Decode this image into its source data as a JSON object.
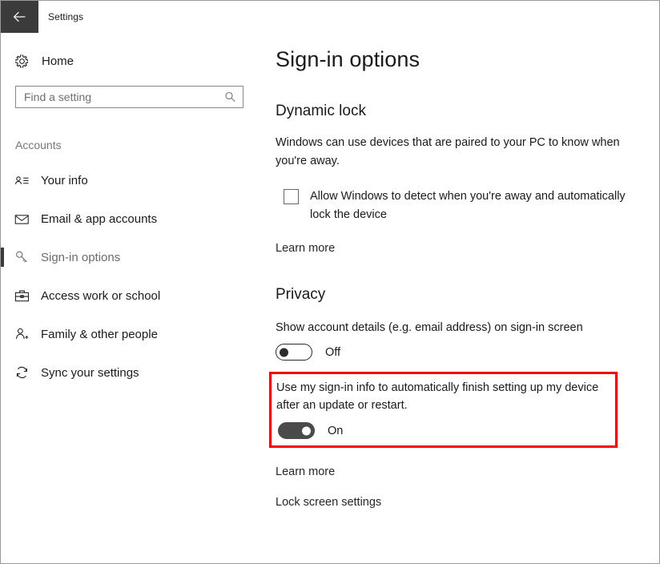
{
  "window": {
    "titlebar": {
      "back_icon": "back-arrow-icon",
      "title": "Settings"
    }
  },
  "sidebar": {
    "home": {
      "icon": "gear-icon",
      "label": "Home"
    },
    "search": {
      "placeholder": "Find a setting",
      "value": "",
      "icon": "search-icon"
    },
    "group_title": "Accounts",
    "items": [
      {
        "icon": "contact-card-icon",
        "label": "Your info",
        "selected": false
      },
      {
        "icon": "envelope-icon",
        "label": "Email & app accounts",
        "selected": false
      },
      {
        "icon": "key-icon",
        "label": "Sign-in options",
        "selected": true
      },
      {
        "icon": "briefcase-icon",
        "label": "Access work or school",
        "selected": false
      },
      {
        "icon": "person-add-icon",
        "label": "Family & other people",
        "selected": false
      },
      {
        "icon": "sync-icon",
        "label": "Sync your settings",
        "selected": false
      }
    ]
  },
  "main": {
    "page_title": "Sign-in options",
    "dynamic_lock": {
      "heading": "Dynamic lock",
      "description": "Windows can use devices that are paired to your PC to know when you're away.",
      "checkbox": {
        "label": "Allow Windows to detect when you're away and automatically lock the device",
        "checked": false
      },
      "learn_more": "Learn more"
    },
    "privacy": {
      "heading": "Privacy",
      "show_account_details": {
        "label": "Show account details (e.g. email address) on sign-in screen",
        "state": "Off",
        "on": false
      },
      "finish_setting_up": {
        "label": "Use my sign-in info to automatically finish setting up my device after an update or restart.",
        "state": "On",
        "on": true,
        "highlighted": true
      },
      "learn_more": "Learn more",
      "lock_screen_settings": "Lock screen settings"
    }
  },
  "colors": {
    "accent_titlebar_back": "#3b3b3b",
    "highlight_border": "#f40000",
    "toggle_on_fill": "#4a4a4a",
    "text_primary": "#1a1a1a",
    "text_muted": "#767676"
  }
}
